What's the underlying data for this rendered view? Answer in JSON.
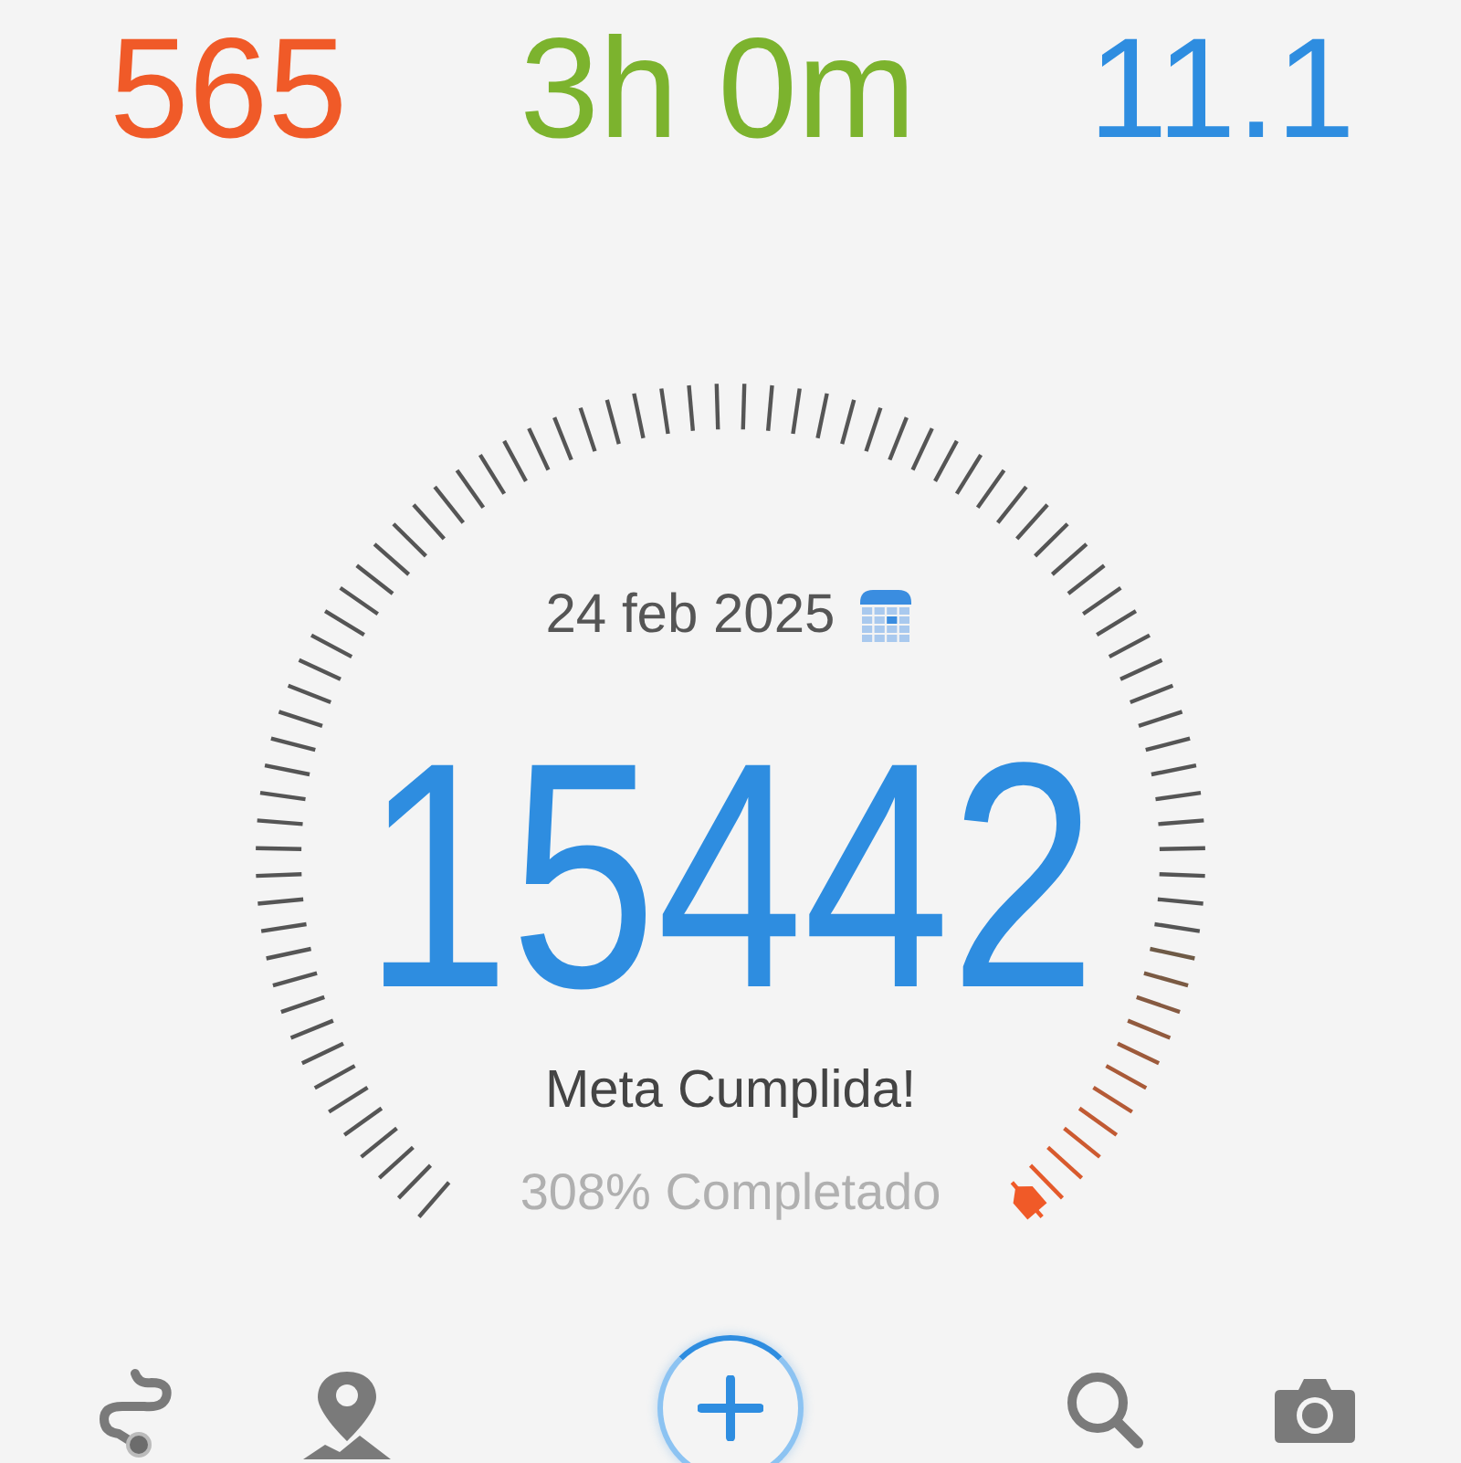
{
  "stats": [
    {
      "value": "565",
      "color": "#f05a28"
    },
    {
      "value": "3h 0m",
      "color": "#7cb32e"
    },
    {
      "value": "11.1",
      "color": "#2e8de0"
    }
  ],
  "date": "24 feb 2025",
  "steps": "15442",
  "status": "Meta Cumplida!",
  "progress": "308% Completado"
}
